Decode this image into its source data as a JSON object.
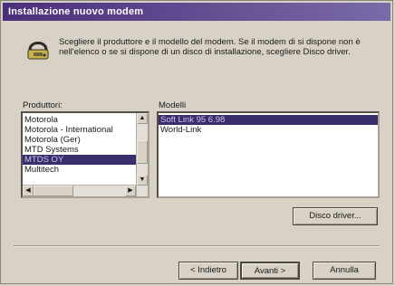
{
  "window": {
    "title": "Installazione nuovo modem"
  },
  "instructions": "Scegliere il produttore e il modello del modem. Se il modem di si dispone non è nell'elenco o se si dispone di un disco di installazione, scegliere Disco driver.",
  "manufacturers": {
    "label": "Produttori:",
    "items": [
      "Motorola",
      "Motorola - International",
      "Motorola (Ger)",
      "MTD Systems",
      "MTDS OY",
      "Multitech"
    ],
    "selected": "MTDS OY"
  },
  "models": {
    "label": "Modelli",
    "items": [
      "Soft Link 95 6.98",
      "World-Link"
    ],
    "selected": "Soft Link 95 6.98"
  },
  "buttons": {
    "disk": "Disco driver...",
    "back": "< Indietro",
    "next": "Avanti >",
    "cancel": "Annulla"
  },
  "icons": {
    "modem": "modem-phone-icon"
  }
}
